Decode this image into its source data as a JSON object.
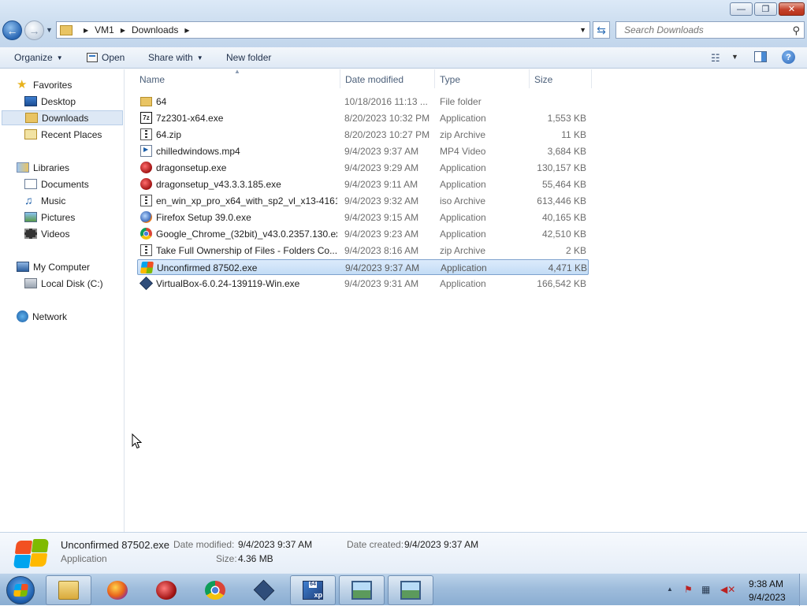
{
  "window": {
    "minimize_glyph": "—",
    "maximize_glyph": "❐",
    "close_glyph": "✕"
  },
  "address": {
    "crumbs": [
      "VM1",
      "Downloads"
    ],
    "search_placeholder": "Search Downloads"
  },
  "toolbar": {
    "organize": "Organize",
    "open": "Open",
    "share_with": "Share with",
    "new_folder": "New folder",
    "help_glyph": "?"
  },
  "nav": {
    "favorites": "Favorites",
    "desktop": "Desktop",
    "downloads": "Downloads",
    "recent_places": "Recent Places",
    "libraries": "Libraries",
    "documents": "Documents",
    "music": "Music",
    "pictures": "Pictures",
    "videos": "Videos",
    "my_computer": "My Computer",
    "local_disk": "Local Disk (C:)",
    "network": "Network"
  },
  "columns": {
    "name": "Name",
    "date_modified": "Date modified",
    "type": "Type",
    "size": "Size"
  },
  "files": [
    {
      "name": "64",
      "date": "10/18/2016 11:13 ...",
      "type": "File folder",
      "size": "",
      "icon": "folder-icon"
    },
    {
      "name": "7z2301-x64.exe",
      "date": "8/20/2023 10:32 PM",
      "type": "Application",
      "size": "1,553 KB",
      "icon": "7zip-icon"
    },
    {
      "name": "64.zip",
      "date": "8/20/2023 10:27 PM",
      "type": "zip Archive",
      "size": "11 KB",
      "icon": "zip-icon"
    },
    {
      "name": "chilledwindows.mp4",
      "date": "9/4/2023 9:37 AM",
      "type": "MP4 Video",
      "size": "3,684 KB",
      "icon": "video-file-icon"
    },
    {
      "name": "dragonsetup.exe",
      "date": "9/4/2023 9:29 AM",
      "type": "Application",
      "size": "130,157 KB",
      "icon": "dragon-icon"
    },
    {
      "name": "dragonsetup_v43.3.3.185.exe",
      "date": "9/4/2023 9:11 AM",
      "type": "Application",
      "size": "55,464 KB",
      "icon": "dragon-icon"
    },
    {
      "name": "en_win_xp_pro_x64_with_sp2_vl_x13-4161...",
      "date": "9/4/2023 9:32 AM",
      "type": "iso Archive",
      "size": "613,446 KB",
      "icon": "zip-icon"
    },
    {
      "name": "Firefox Setup 39.0.exe",
      "date": "9/4/2023 9:15 AM",
      "type": "Application",
      "size": "40,165 KB",
      "icon": "firefox-icon"
    },
    {
      "name": "Google_Chrome_(32bit)_v43.0.2357.130.exe",
      "date": "9/4/2023 9:23 AM",
      "type": "Application",
      "size": "42,510 KB",
      "icon": "chrome-icon"
    },
    {
      "name": "Take Full Ownership of Files - Folders Co...",
      "date": "9/4/2023 8:16 AM",
      "type": "zip Archive",
      "size": "2 KB",
      "icon": "zip-icon"
    },
    {
      "name": "Unconfirmed 87502.exe",
      "date": "9/4/2023 9:37 AM",
      "type": "Application",
      "size": "4,471 KB",
      "icon": "windows-flag-icon",
      "selected": true
    },
    {
      "name": "VirtualBox-6.0.24-139119-Win.exe",
      "date": "9/4/2023 9:31 AM",
      "type": "Application",
      "size": "166,542 KB",
      "icon": "virtualbox-icon"
    }
  ],
  "details": {
    "filename": "Unconfirmed 87502.exe",
    "filetype": "Application",
    "date_modified_label": "Date modified:",
    "date_modified": "9/4/2023 9:37 AM",
    "date_created_label": "Date created:",
    "date_created": "9/4/2023 9:37 AM",
    "size_label": "Size:",
    "size": "4.36 MB"
  },
  "taskbar": {
    "xp_badge_top": "64",
    "xp_badge": "xp",
    "time": "9:38 AM",
    "date": "9/4/2023",
    "tray_arrow": "▲"
  }
}
